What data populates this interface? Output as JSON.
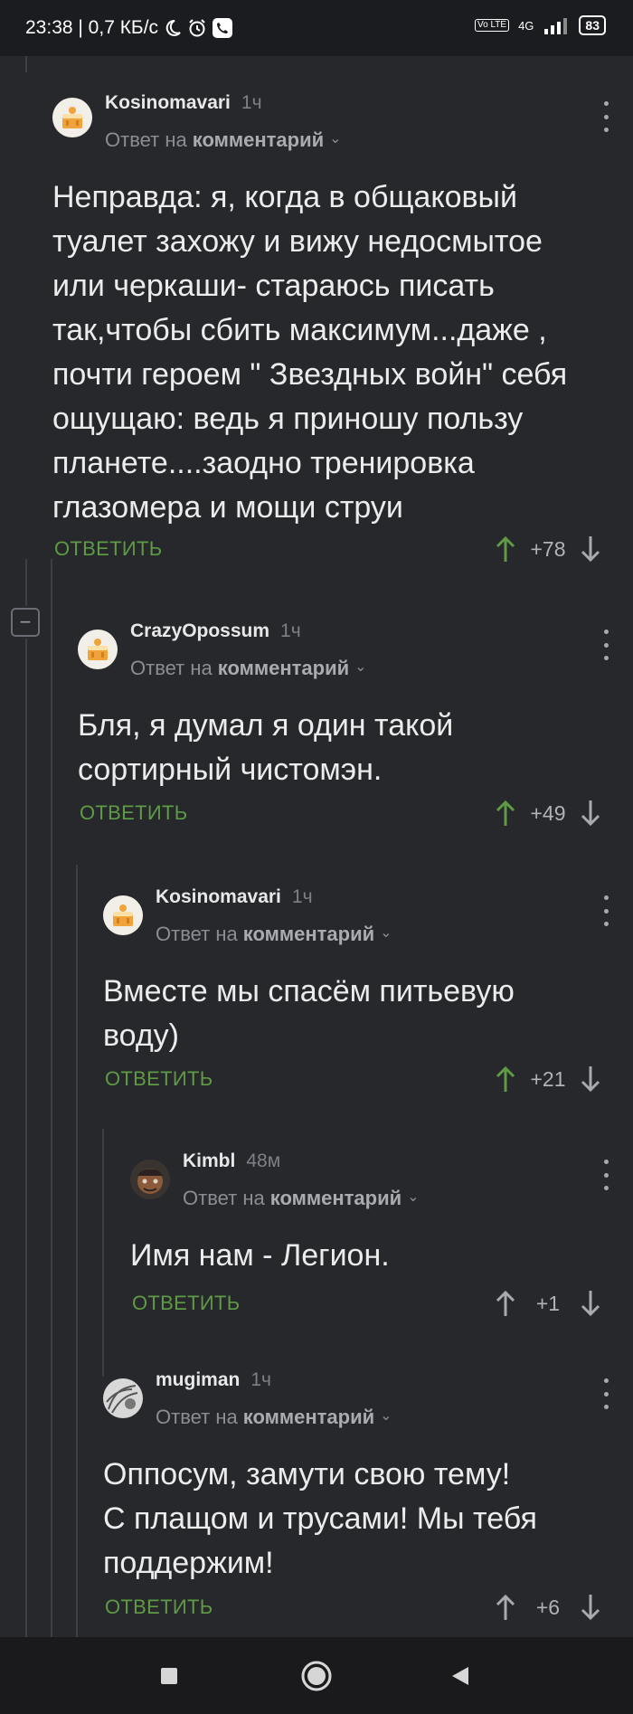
{
  "status_bar": {
    "time_speed": "23:38 | 0,7 КБ/с",
    "network": "4G",
    "volte": "Vo LTE",
    "battery": "83"
  },
  "colors": {
    "background": "#26282c",
    "accent_green": "#5f9a45",
    "muted": "#8a8d93"
  },
  "comments": [
    {
      "author": "Kosinomavari",
      "time": "1ч",
      "reply_prefix": "Ответ на",
      "reply_target": "комментарий",
      "lines": [
        "Неправда: я, когда в общаковый",
        "туалет захожу и вижу недосмытое",
        "или черкаши- стараюсь писать",
        "так,чтобы сбить максимум...даже ,",
        "почти героем \" Звездных войн\" себя",
        "ощущаю: ведь я приношу пользу",
        "планете....заодно тренировка",
        "глазомера и мощи струи"
      ],
      "reply_label": "ОТВЕТИТЬ",
      "score": "+78",
      "avatar_icon": "cake-avatar-icon"
    },
    {
      "author": "CrazyOpossum",
      "time": "1ч",
      "reply_prefix": "Ответ на",
      "reply_target": "комментарий",
      "lines": [
        "Бля, я думал я один такой",
        "сортирный чистомэн."
      ],
      "reply_label": "ОТВЕТИТЬ",
      "score": "+49",
      "avatar_icon": "cake-avatar-icon"
    },
    {
      "author": "Kosinomavari",
      "time": "1ч",
      "reply_prefix": "Ответ на",
      "reply_target": "комментарий",
      "lines": [
        "Вместе мы спасём питьевую",
        "воду)"
      ],
      "reply_label": "ОТВЕТИТЬ",
      "score": "+21",
      "avatar_icon": "cake-avatar-icon"
    },
    {
      "author": "Kimbl",
      "time": "48м",
      "reply_prefix": "Ответ на",
      "reply_target": "комментарий",
      "lines": [
        "Имя нам - Легион."
      ],
      "reply_label": "ОТВЕТИТЬ",
      "score": "+1",
      "avatar_icon": "face-avatar-icon"
    },
    {
      "author": "mugiman",
      "time": "1ч",
      "reply_prefix": "Ответ на",
      "reply_target": "комментарий",
      "lines": [
        "Оппосум, замути свою тему!",
        "С плащом и трусами! Мы тебя",
        "поддержим!"
      ],
      "reply_label": "ОТВЕТИТЬ",
      "score": "+6",
      "avatar_icon": "sketch-avatar-icon"
    }
  ],
  "collapse_symbol": "−",
  "nav": [
    "square-icon",
    "circle-home-icon",
    "back-triangle-icon"
  ]
}
